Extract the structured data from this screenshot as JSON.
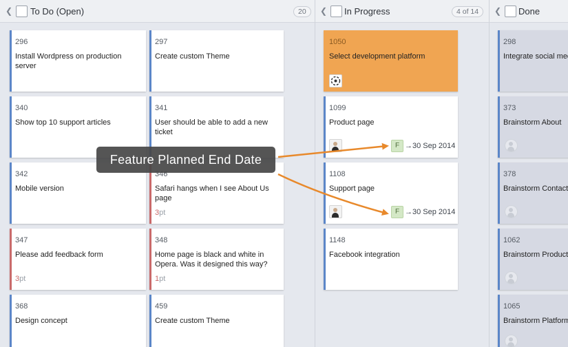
{
  "columns": [
    {
      "title": "To Do (Open)",
      "count": "20"
    },
    {
      "title": "In Progress",
      "count": "4 of 14"
    },
    {
      "title": "Done"
    }
  ],
  "todo": [
    {
      "id": "296",
      "title": "Install Wordpress on production server"
    },
    {
      "id": "297",
      "title": "Create custom Theme"
    },
    {
      "id": "340",
      "title": "Show top 10 support articles"
    },
    {
      "id": "341",
      "title": "User should be able to add a new ticket"
    },
    {
      "id": "342",
      "title": "Mobile version"
    },
    {
      "id": "346",
      "title": "Safari hangs when I see About Us page",
      "points": "3",
      "unit": "pt"
    },
    {
      "id": "347",
      "title": "Please add feedback form",
      "points": "3",
      "unit": "pt"
    },
    {
      "id": "348",
      "title": "Home page is black and white in Opera. Was it designed this way?",
      "points": "1",
      "unit": "pt"
    },
    {
      "id": "368",
      "title": "Design concept"
    },
    {
      "id": "459",
      "title": "Create custom Theme"
    }
  ],
  "in_progress": [
    {
      "id": "1050",
      "title": "Select development platform"
    },
    {
      "id": "1099",
      "title": "Product page",
      "feature": "F",
      "end_date": "→30 Sep 2014"
    },
    {
      "id": "1108",
      "title": "Support page",
      "feature": "F",
      "end_date": "→30 Sep 2014"
    },
    {
      "id": "1148",
      "title": "Facebook integration"
    }
  ],
  "done": [
    {
      "id": "298",
      "title": "Integrate social media"
    },
    {
      "id": "373",
      "title": "Brainstorm About"
    },
    {
      "id": "378",
      "title": "Brainstorm Contact"
    },
    {
      "id": "1062",
      "title": "Brainstorm Product"
    },
    {
      "id": "1065",
      "title": "Brainstorm Platform"
    }
  ],
  "tooltip": "Feature Planned End Date",
  "colors": {
    "accent_blue": "#5b86c8",
    "bug_red": "#c96a6a",
    "highlight_orange": "#f0a552",
    "arrow_orange": "#e8892b"
  }
}
